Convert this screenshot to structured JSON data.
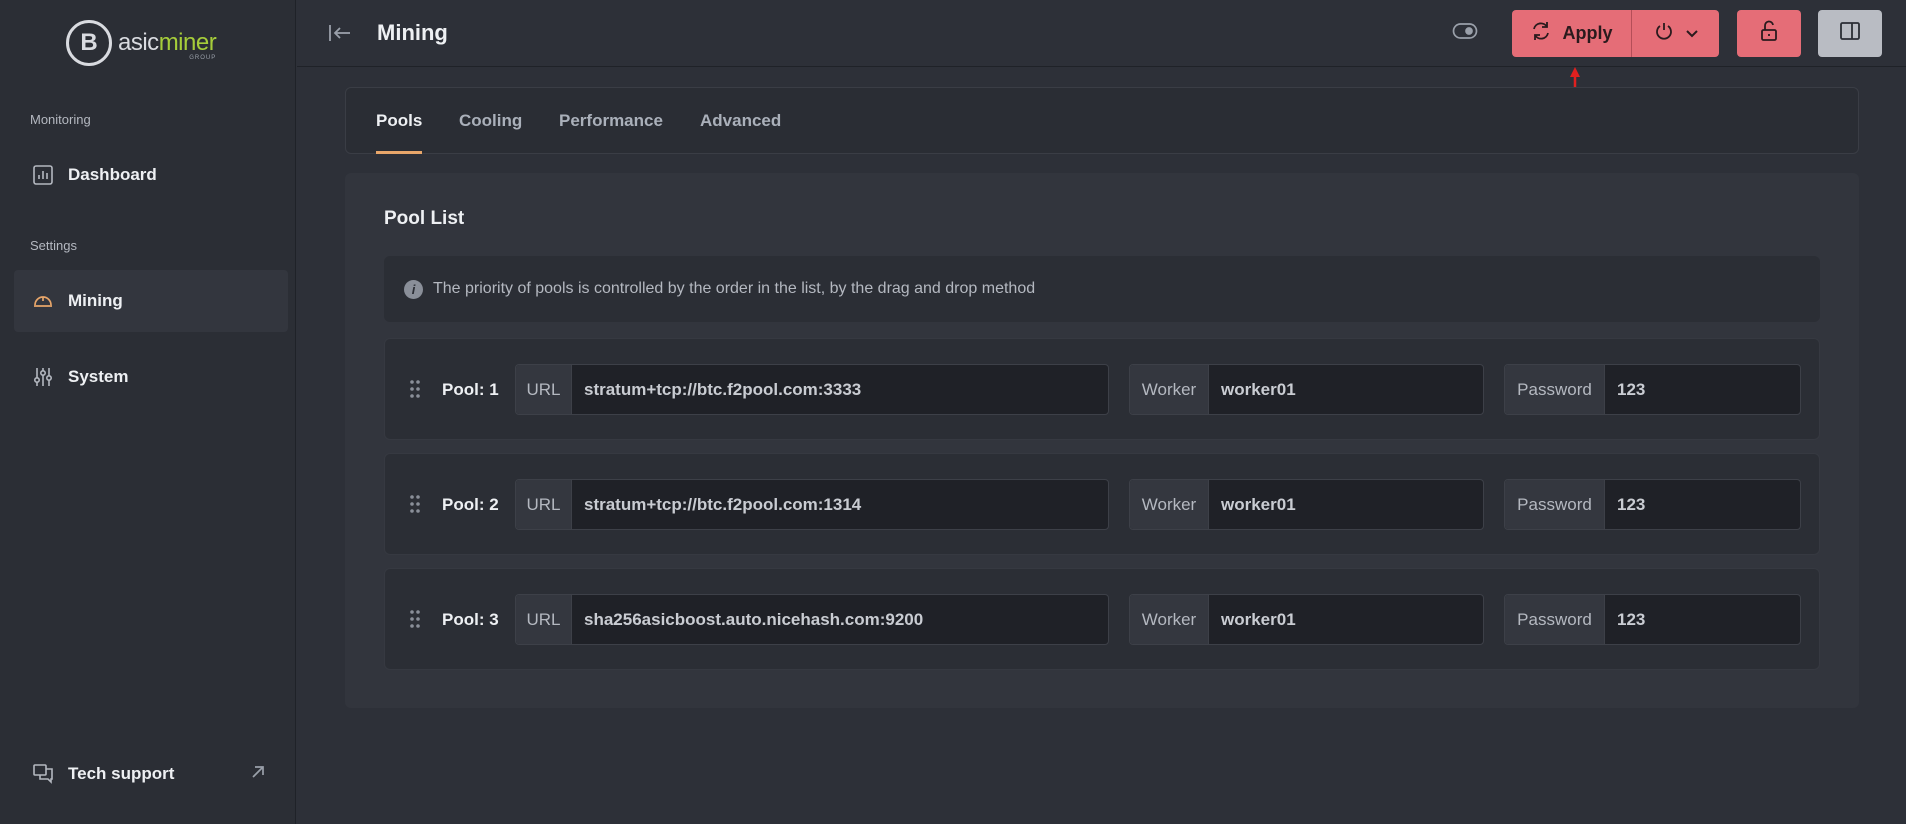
{
  "brand": {
    "logo_glyph": "B",
    "name_part1": "asic",
    "name_part2": "miner",
    "sub": "GROUP",
    "accent_color": "#a6cd3a"
  },
  "sidebar": {
    "sections": [
      {
        "label": "Monitoring"
      },
      {
        "label": "Settings"
      }
    ],
    "items": [
      {
        "label": "Dashboard",
        "icon": "chart-icon",
        "active": false
      },
      {
        "label": "Mining",
        "icon": "helmet-icon",
        "active": true
      },
      {
        "label": "System",
        "icon": "sliders-icon",
        "active": false
      }
    ],
    "tech_support": {
      "label": "Tech support",
      "icon": "chat-icon",
      "external_icon": "external-link-icon"
    }
  },
  "header": {
    "title": "Mining",
    "apply_label": "Apply",
    "apply_color": "#e56d77"
  },
  "tabs": [
    {
      "label": "Pools",
      "active": true
    },
    {
      "label": "Cooling",
      "active": false
    },
    {
      "label": "Performance",
      "active": false
    },
    {
      "label": "Advanced",
      "active": false
    }
  ],
  "pool_list": {
    "title": "Pool List",
    "info": "The priority of pools is controlled by the order in the list, by the drag and drop method",
    "url_label": "URL",
    "worker_label": "Worker",
    "password_label": "Password",
    "pools": [
      {
        "label": "Pool: 1",
        "url": "stratum+tcp://btc.f2pool.com:3333",
        "worker": "worker01",
        "password": "123"
      },
      {
        "label": "Pool: 2",
        "url": "stratum+tcp://btc.f2pool.com:1314",
        "worker": "worker01",
        "password": "123"
      },
      {
        "label": "Pool: 3",
        "url": "sha256asicboost.auto.nicehash.com:9200",
        "worker": "worker01",
        "password": "123"
      }
    ]
  }
}
